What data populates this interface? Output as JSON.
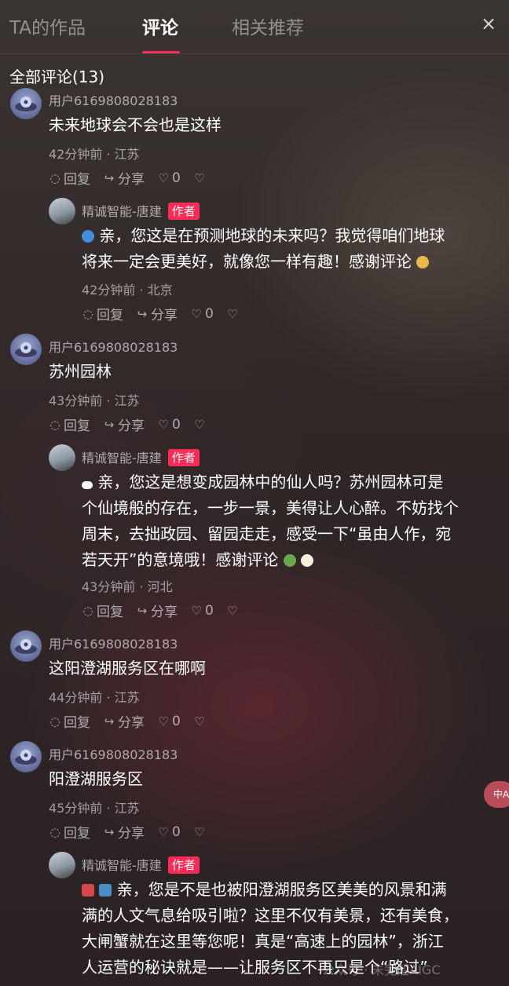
{
  "tabs": [
    "TA的作品",
    "评论",
    "相关推荐"
  ],
  "close_icon": "×",
  "comments_header": "全部评论(13)",
  "actions": {
    "reply": "回复",
    "share": "分享",
    "like_count": "0"
  },
  "author_badge": "作者",
  "comments": [
    {
      "user": "用户6169808028183",
      "text": "未来地球会不会也是这样",
      "meta": "42分钟前 · 江苏",
      "reply": {
        "user": "精诚智能-唐建",
        "lines": [
          "亲，您这是在预测地球的未来吗？我觉得咱们地球",
          "将来一定会更美好，就像您一样有趣！感谢评论"
        ],
        "meta": "42分钟前 · 北京"
      }
    },
    {
      "user": "用户6169808028183",
      "text": "苏州园林",
      "meta": "43分钟前 · 江苏",
      "reply": {
        "user": "精诚智能-唐建",
        "lines": [
          "亲，您这是想变成园林中的仙人吗？苏州园林可是",
          "个仙境般的存在，一步一景，美得让人心醉。不妨找个",
          "周末，去拙政园、留园走走，感受一下“虽由人作，宛",
          "若天开”的意境哦！感谢评论"
        ],
        "meta": "43分钟前 · 河北"
      }
    },
    {
      "user": "用户6169808028183",
      "text": "这阳澄湖服务区在哪啊",
      "meta": "44分钟前 · 江苏"
    },
    {
      "user": "用户6169808028183",
      "text": "阳澄湖服务区",
      "meta": "45分钟前 · 江苏",
      "reply": {
        "user": "精诚智能-唐建",
        "lines": [
          "亲，您是不是也被阳澄湖服务区美美的风景和满",
          "满的人文气息给吸引啦？这里不仅有美景，还有美食，",
          "大闸蟹就在这里等您呢！真是“高速上的园林”，浙江",
          "人运营的秘诀就是——让服务区不再只是个“路过”"
        ]
      }
    }
  ],
  "side_pill": "中A",
  "watermark": "公众号 · 未完船AIGC",
  "colors": {
    "accent": "#fe2c55"
  }
}
